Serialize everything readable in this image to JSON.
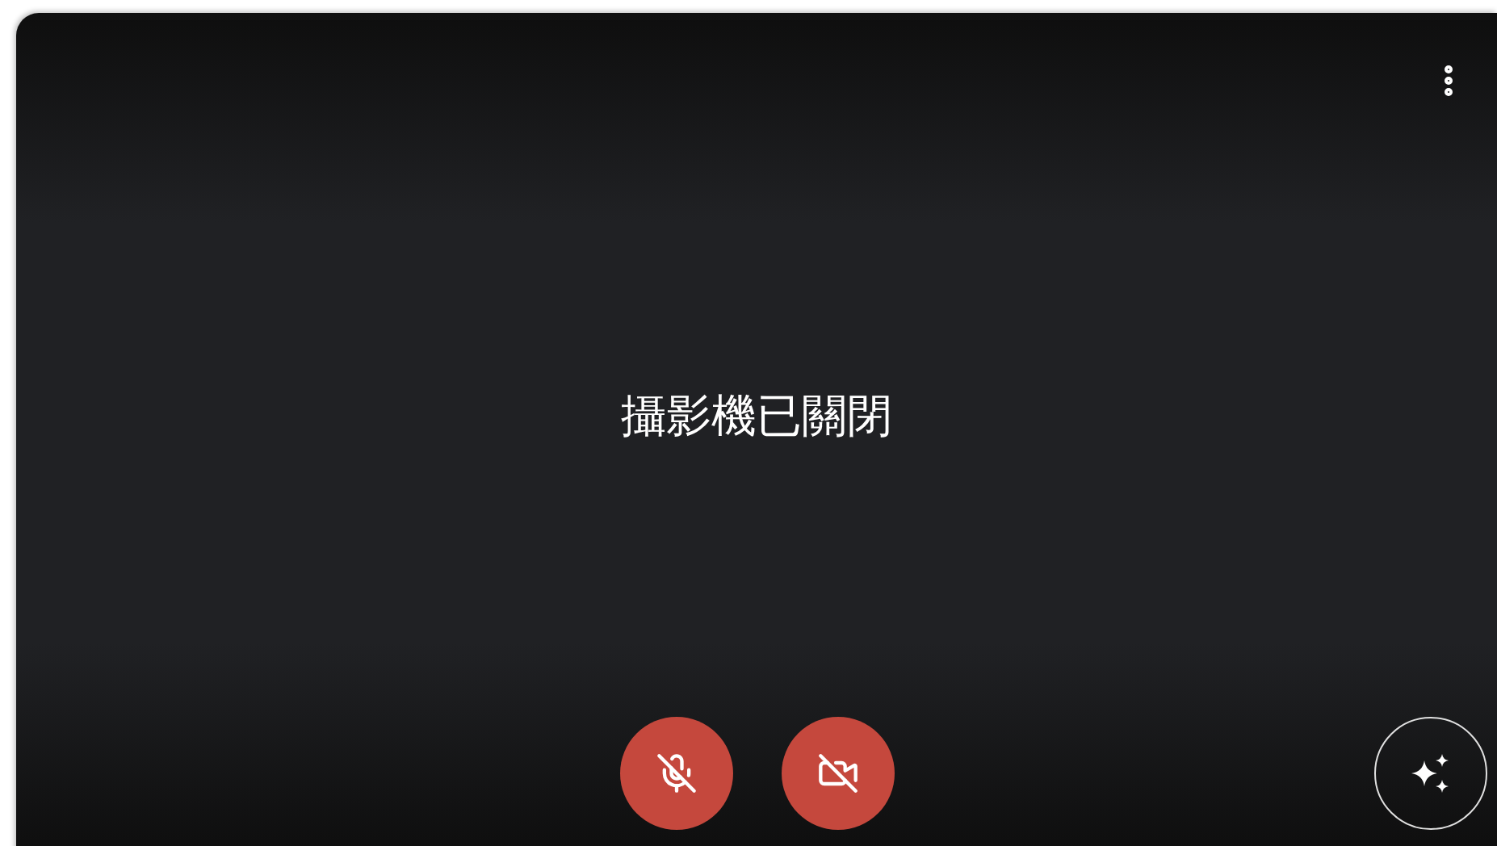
{
  "status_message": "攝影機已關閉",
  "controls": {
    "microphone": {
      "muted": true
    },
    "camera": {
      "off": true
    }
  }
}
